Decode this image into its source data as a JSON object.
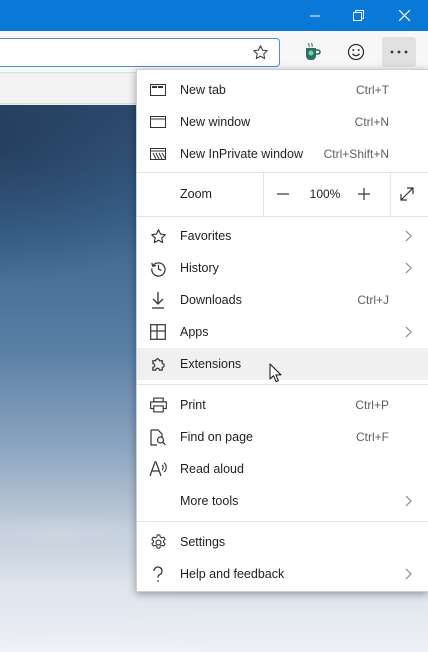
{
  "window": {
    "controls": {
      "minimize_icon": "minimize-icon",
      "restore_icon": "restore-icon",
      "close_icon": "close-icon"
    },
    "accent": "#0a78d7"
  },
  "toolbar": {
    "favorite_icon": "star-outline-icon",
    "extension_icon": "coffee-cup-extension-icon",
    "feedback_icon": "smiley-icon",
    "menu_icon": "ellipsis-icon"
  },
  "menu": {
    "items": [
      {
        "label": "New tab",
        "shortcut": "Ctrl+T",
        "icon": "new-tab-icon"
      },
      {
        "label": "New window",
        "shortcut": "Ctrl+N",
        "icon": "new-window-icon"
      },
      {
        "label": "New InPrivate window",
        "shortcut": "Ctrl+Shift+N",
        "icon": "inprivate-icon"
      }
    ],
    "zoom": {
      "label": "Zoom",
      "value": "100%",
      "minus": "–",
      "plus": "+",
      "fullscreen_icon": "fullscreen-icon"
    },
    "group2": [
      {
        "label": "Favorites",
        "icon": "star-icon",
        "submenu": true
      },
      {
        "label": "History",
        "icon": "history-icon",
        "submenu": true
      },
      {
        "label": "Downloads",
        "shortcut": "Ctrl+J",
        "icon": "download-icon"
      },
      {
        "label": "Apps",
        "icon": "apps-icon",
        "submenu": true
      },
      {
        "label": "Extensions",
        "icon": "puzzle-icon",
        "hovered": true
      }
    ],
    "group3": [
      {
        "label": "Print",
        "shortcut": "Ctrl+P",
        "icon": "printer-icon"
      },
      {
        "label": "Find on page",
        "shortcut": "Ctrl+F",
        "icon": "find-icon"
      },
      {
        "label": "Read aloud",
        "icon": "read-aloud-icon"
      },
      {
        "label": "More tools",
        "submenu": true
      }
    ],
    "group4": [
      {
        "label": "Settings",
        "icon": "gear-icon"
      },
      {
        "label": "Help and feedback",
        "icon": "help-icon",
        "submenu": true
      }
    ]
  }
}
